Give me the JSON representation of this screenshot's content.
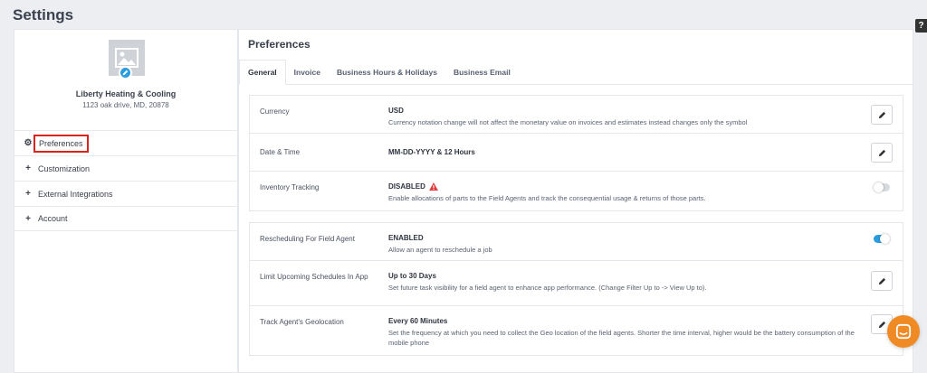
{
  "page": {
    "title": "Settings",
    "help_icon": "?"
  },
  "sidebar": {
    "company_name": "Liberty Heating & Cooling",
    "company_address": "1123 oak drive, MD, 20878",
    "menu": [
      {
        "label": "Preferences",
        "icon": "gear-icon",
        "icon_glyph": "⚙"
      },
      {
        "label": "Customization",
        "icon": "plus-icon",
        "icon_glyph": "+"
      },
      {
        "label": "External Integrations",
        "icon": "plus-icon",
        "icon_glyph": "+"
      },
      {
        "label": "Account",
        "icon": "plus-icon",
        "icon_glyph": "+"
      }
    ]
  },
  "main": {
    "title": "Preferences",
    "tabs": [
      {
        "label": "General",
        "active": true
      },
      {
        "label": "Invoice"
      },
      {
        "label": "Business Hours & Holidays"
      },
      {
        "label": "Business Email"
      }
    ],
    "rows": [
      {
        "label": "Currency",
        "value": "USD",
        "desc": "Currency notation change will not affect the monetary value on invoices and estimates instead changes only the symbol",
        "control": "edit"
      },
      {
        "label": "Date & Time",
        "value": "MM-DD-YYYY & 12 Hours",
        "desc": "",
        "control": "edit"
      },
      {
        "label": "Inventory Tracking",
        "value": "DISABLED",
        "desc": "Enable allocations of parts to the Field Agents and track the consequential usage & returns of those parts.",
        "control": "toggle",
        "toggle_on": false,
        "warning": true
      },
      {
        "label": "Rescheduling For Field Agent",
        "value": "ENABLED",
        "desc": "Allow an agent to reschedule a job",
        "control": "toggle",
        "toggle_on": true
      },
      {
        "label": "Limit Upcoming Schedules In App",
        "value": "Up to 30 Days",
        "desc": "Set future task visibility for a field agent to enhance app performance. (Change Filter Up to -> View Up to).",
        "control": "edit"
      },
      {
        "label": "Track Agent's Geolocation",
        "value": "Every 60 Minutes",
        "desc": "Set the frequency at which you need to collect the Geo location of the field agents. Shorter the time interval, higher would be the battery consumption of the mobile phone",
        "control": "edit"
      }
    ]
  },
  "colors": {
    "accent": "#2a9de0",
    "highlight_border": "#d8231f",
    "warning": "#e03a3a",
    "chat": "#f08a24"
  }
}
